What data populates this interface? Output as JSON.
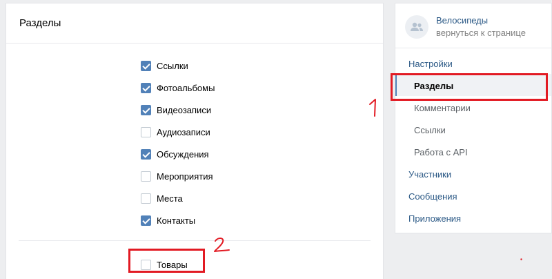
{
  "sections_panel": {
    "title": "Разделы",
    "items": [
      {
        "label": "Ссылки",
        "checked": true
      },
      {
        "label": "Фотоальбомы",
        "checked": true
      },
      {
        "label": "Видеозаписи",
        "checked": true
      },
      {
        "label": "Аудиозаписи",
        "checked": false
      },
      {
        "label": "Обсуждения",
        "checked": true
      },
      {
        "label": "Мероприятия",
        "checked": false
      },
      {
        "label": "Места",
        "checked": false
      },
      {
        "label": "Контакты",
        "checked": true
      }
    ],
    "extra_item": {
      "label": "Товары",
      "checked": false
    }
  },
  "sidebar": {
    "group_name": "Велосипеды",
    "back_link": "вернуться к странице",
    "avatar_icon": "group-icon",
    "menu": [
      {
        "label": "Настройки"
      },
      {
        "label": "Разделы",
        "active": true
      },
      {
        "label": "Комментарии"
      },
      {
        "label": "Ссылки"
      },
      {
        "label": "Работа с API"
      },
      {
        "label": "Участники"
      },
      {
        "label": "Сообщения"
      },
      {
        "label": "Приложения"
      }
    ]
  },
  "colors": {
    "accent": "#5181b8",
    "link": "#2a5885",
    "annotation": "#e21a23"
  }
}
